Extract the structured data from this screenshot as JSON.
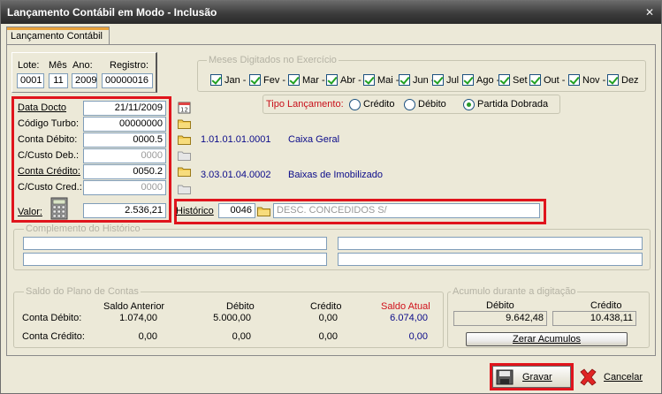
{
  "window": {
    "title": "Lançamento Contábil em Modo - Inclusão",
    "close": "✕"
  },
  "tab": {
    "label": "Lançamento  Contábil"
  },
  "header_fields": {
    "lote_label": "Lote:",
    "mes_label": "Mês",
    "ano_label": "Ano:",
    "registro_label": "Registro:",
    "lote": "0001",
    "mes": "11",
    "ano": "2009",
    "registro": "00000016"
  },
  "form": {
    "data_docto_label": "Data Docto",
    "data_docto": "21/11/2009",
    "codigo_turbo_label": "Código Turbo:",
    "codigo_turbo": "00000000",
    "conta_debito_label": "Conta Débito:",
    "conta_debito": "0000.5",
    "ccusto_deb_label": "C/Custo Deb.:",
    "ccusto_deb": "0000",
    "conta_credito_label": "Conta Crédito:",
    "conta_credito": "0050.2",
    "ccusto_cred_label": "C/Custo Cred.:",
    "ccusto_cred": "0000",
    "valor_label": "Valor:",
    "valor": "2.536,21"
  },
  "accounts": {
    "debit_code": "1.01.01.01.0001",
    "debit_name": "Caixa Geral",
    "credit_code": "3.03.01.04.0002",
    "credit_name": "Baixas de Imobilizado"
  },
  "historico": {
    "label": "Histórico",
    "code": "0046",
    "text": "DESC. CONCEDIDOS S/"
  },
  "meses": {
    "title": "Meses Digitados no Exercício",
    "items": [
      "Jan -",
      "Fev -",
      "Mar -",
      "Abr -",
      "Mai -",
      "Jun -",
      "Jul",
      "Ago -",
      "Set -",
      "Out -",
      "Nov -",
      "Dez"
    ]
  },
  "tipo_lancamento": {
    "label": "Tipo Lançamento:",
    "options": [
      "Crédito",
      "Débito",
      "Partida Dobrada"
    ],
    "selected": "Partida Dobrada"
  },
  "complemento": {
    "title": "Complemento do Histórico"
  },
  "saldo": {
    "title": "Saldo do Plano de Contas",
    "col_saldo_anterior": "Saldo Anterior",
    "col_debito": "Débito",
    "col_credito": "Crédito",
    "col_saldo_atual": "Saldo Atual",
    "row_debito_label": "Conta Débito:",
    "row_credito_label": "Conta Crédito:",
    "deb_saldo_anterior": "1.074,00",
    "deb_debito": "5.000,00",
    "deb_credito": "0,00",
    "deb_saldo_atual": "6.074,00",
    "cred_saldo_anterior": "0,00",
    "cred_debito": "0,00",
    "cred_credito": "0,00",
    "cred_saldo_atual": "0,00"
  },
  "acumulo": {
    "title": "Acumulo durante a digitação",
    "debito_label": "Débito",
    "credito_label": "Crédito",
    "debito": "9.642,48",
    "credito": "10.438,11",
    "zerar_label": "Zerar Acumulos"
  },
  "buttons": {
    "gravar": "Gravar",
    "cancelar": "Cancelar"
  },
  "colors": {
    "highlight": "#e0141c",
    "saldo_atual": "#d0101a",
    "link": "#0b0b8a"
  }
}
